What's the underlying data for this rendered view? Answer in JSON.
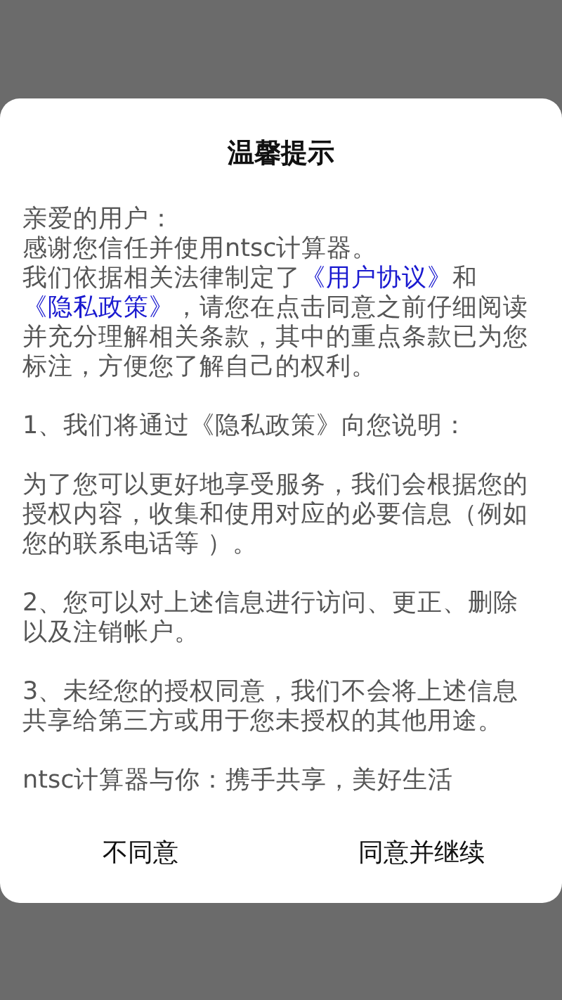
{
  "dialog": {
    "title": "温馨提示",
    "sections": [
      [
        {
          "parts": [
            {
              "kind": "text",
              "text": "亲爱的用户："
            }
          ]
        },
        {
          "parts": [
            {
              "kind": "text",
              "text": "感谢您信任并使用ntsc计算器。"
            }
          ]
        },
        {
          "parts": [
            {
              "kind": "text",
              "text": "我们依据相关法律制定了"
            },
            {
              "kind": "link",
              "text": "《用户协议》"
            },
            {
              "kind": "text",
              "text": "和"
            },
            {
              "kind": "link",
              "text": "《隐私政策》"
            },
            {
              "kind": "text",
              "text": "，请您在点击同意之前仔细阅读并充分理解相关条款，其中的重点条款已为您标注，方便您了解自己的权利。"
            }
          ]
        }
      ],
      [
        {
          "parts": [
            {
              "kind": "text",
              "text": "1、我们将通过《隐私政策》向您说明："
            }
          ]
        }
      ],
      [
        {
          "parts": [
            {
              "kind": "text",
              "text": "为了您可以更好地享受服务，我们会根据您的授权内容，收集和使用对应的必要信息（例如您的联系电话等 ）。"
            }
          ]
        }
      ],
      [
        {
          "parts": [
            {
              "kind": "text",
              "text": "2、您可以对上述信息进行访问、更正、删除以及注销帐户。"
            }
          ]
        }
      ],
      [
        {
          "parts": [
            {
              "kind": "text",
              "text": "3、未经您的授权同意，我们不会将上述信息共享给第三方或用于您未授权的其他用途。"
            }
          ]
        }
      ],
      [
        {
          "parts": [
            {
              "kind": "text",
              "text": "ntsc计算器与你：携手共享，美好生活"
            }
          ]
        }
      ]
    ],
    "buttons": [
      "不同意",
      "同意并继续"
    ]
  }
}
